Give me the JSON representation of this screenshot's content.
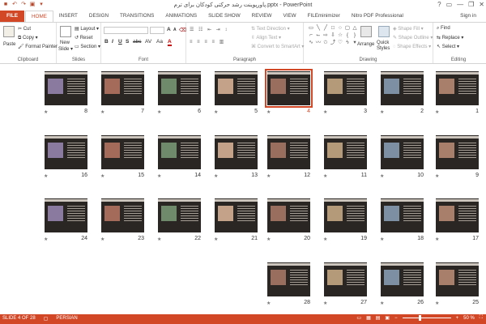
{
  "window": {
    "title": "پاورپوینت رشد حرکتی کودکان برای ترم.pptx - PowerPoint",
    "signin": "Sign in",
    "help": "?",
    "minimize": "—",
    "restore": "❐",
    "close": "✕"
  },
  "qat": [
    "save",
    "undo",
    "redo",
    "start-from-beginning"
  ],
  "tabs": {
    "file": "FILE",
    "items": [
      "HOME",
      "INSERT",
      "DESIGN",
      "TRANSITIONS",
      "ANIMATIONS",
      "SLIDE SHOW",
      "REVIEW",
      "VIEW",
      "FILEminimizer",
      "Nitro PDF Professional"
    ],
    "active": "HOME"
  },
  "ribbon": {
    "clipboard": {
      "label": "Clipboard",
      "paste": "Paste",
      "cut": "Cut",
      "copy": "Copy",
      "format_painter": "Format Painter"
    },
    "slides": {
      "label": "Slides",
      "new_slide": "New",
      "new_slide2": "Slide",
      "layout": "Layout",
      "reset": "Reset",
      "section": "Section"
    },
    "font": {
      "label": "Font",
      "font_name": "",
      "font_size": "",
      "bold": "B",
      "italic": "I",
      "underline": "U",
      "shadow": "S",
      "strike": "abc",
      "spacing": "AV",
      "case": "Aa",
      "color": "A",
      "grow": "A",
      "shrink": "A"
    },
    "paragraph": {
      "label": "Paragraph",
      "text_direction": "Text Direction",
      "align_text": "Align Text",
      "convert_smartart": "Convert to SmartArt"
    },
    "drawing": {
      "label": "Drawing",
      "arrange": "Arrange",
      "quick_styles": "Quick",
      "quick_styles2": "Styles",
      "shape_fill": "Shape Fill",
      "shape_outline": "Shape Outline",
      "shape_effects": "Shape Effects"
    },
    "editing": {
      "label": "Editing",
      "find": "Find",
      "replace": "Replace",
      "select": "Select"
    }
  },
  "slides": {
    "selected": 4,
    "items": [
      "1",
      "2",
      "3",
      "4",
      "5",
      "6",
      "7",
      "8",
      "9",
      "10",
      "11",
      "12",
      "13",
      "14",
      "15",
      "16",
      "17",
      "18",
      "19",
      "20",
      "21",
      "22",
      "23",
      "24",
      "25",
      "26",
      "27",
      "28"
    ]
  },
  "status": {
    "slide_of": "SLIDE 4 OF 28",
    "language": "PERSIAN",
    "zoom": "50 %"
  },
  "colors": {
    "accent": "#d24726",
    "slide_bg": "#2a2624"
  }
}
